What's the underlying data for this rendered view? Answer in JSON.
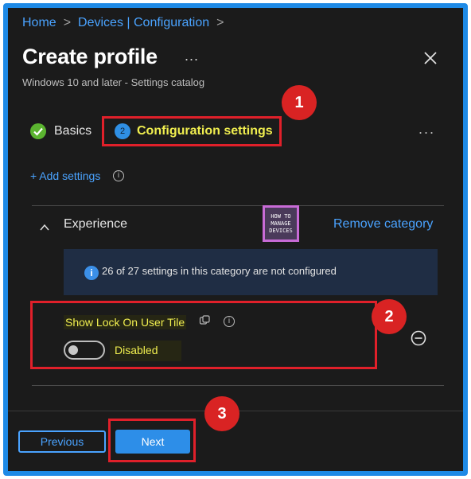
{
  "breadcrumb": {
    "home": "Home",
    "sep1": ">",
    "devices": "Devices | Configuration",
    "sep2": ">"
  },
  "header": {
    "title": "Create profile",
    "more": "...",
    "subtitle": "Windows 10 and later - Settings catalog"
  },
  "steps": {
    "basics": "Basics",
    "config_num": "2",
    "config_label": "Configuration settings",
    "overflow": "..."
  },
  "add_settings": {
    "label": "+ Add settings",
    "info": "i"
  },
  "category": {
    "name": "Experience",
    "remove": "Remove category",
    "banner_icon": "i",
    "banner": "26 of 27 settings in this category are not configured"
  },
  "logo": {
    "line1": "HOW TO",
    "line2": "MANAGE",
    "line3": "DEVICES"
  },
  "setting": {
    "label": "Show Lock On User Tile",
    "info": "i",
    "value": "Disabled",
    "enabled": false
  },
  "callouts": {
    "one": "1",
    "two": "2",
    "three": "3"
  },
  "footer": {
    "previous": "Previous",
    "next": "Next"
  },
  "colors": {
    "accent": "#4aa3ff",
    "primary_button": "#2d8ee8",
    "highlight_text": "#f0ee4f",
    "callout_red": "#d92323",
    "success_green": "#5bb430"
  }
}
